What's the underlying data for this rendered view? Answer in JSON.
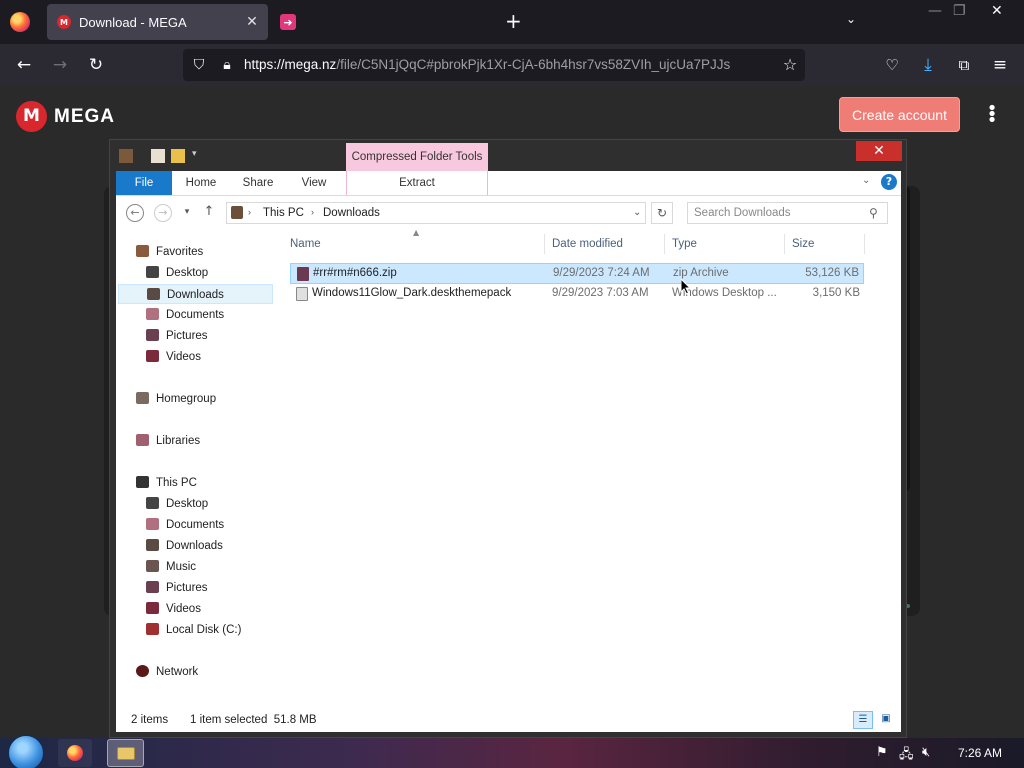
{
  "browser": {
    "active_tab": {
      "title": "Download - MEGA",
      "favicon": "mega-favicon-icon"
    },
    "second_tab": {
      "favicon": "pink-arrow-favicon-icon"
    },
    "url_origin": "https://mega.nz",
    "url_path": "/file/C5N1jQqC#pbrokPjk1Xr-CjA-6bh4hsr7vs58ZVIh_ujcUa7PJJs"
  },
  "mega": {
    "brand": "MEGA",
    "create_account": "Create account"
  },
  "explorer": {
    "contextual_tab": "Compressed Folder Tools",
    "ribbon_tabs": [
      "File",
      "Home",
      "Share",
      "View"
    ],
    "extract_tab": "Extract",
    "breadcrumb": [
      "This PC",
      "Downloads"
    ],
    "search_placeholder": "Search Downloads",
    "columns": {
      "name": "Name",
      "date": "Date modified",
      "type": "Type",
      "size": "Size"
    },
    "nav": {
      "favorites": "Favorites",
      "fav_items": [
        "Desktop",
        "Downloads",
        "Documents",
        "Pictures",
        "Videos"
      ],
      "homegroup": "Homegroup",
      "libraries": "Libraries",
      "this_pc": "This PC",
      "pc_items": [
        "Desktop",
        "Documents",
        "Downloads",
        "Music",
        "Pictures",
        "Videos",
        "Local Disk (C:)"
      ],
      "network": "Network"
    },
    "files": [
      {
        "name": "#rr#rm#n666.zip",
        "date": "9/29/2023 7:24 AM",
        "type": "zip Archive",
        "size": "53,126 KB"
      },
      {
        "name": "Windows11Glow_Dark.deskthemepack",
        "date": "9/29/2023 7:03 AM",
        "type": "Windows Desktop ...",
        "size": "3,150 KB"
      }
    ],
    "status": {
      "count": "2 items",
      "selected": "1 item selected  51.8 MB"
    }
  },
  "taskbar": {
    "clock": "7:26 AM"
  },
  "colors": {
    "accent_blue": "#1979ca",
    "mega_red": "#d9272e",
    "selection": "#cce8ff",
    "contextual_pink": "#f8c8de"
  }
}
